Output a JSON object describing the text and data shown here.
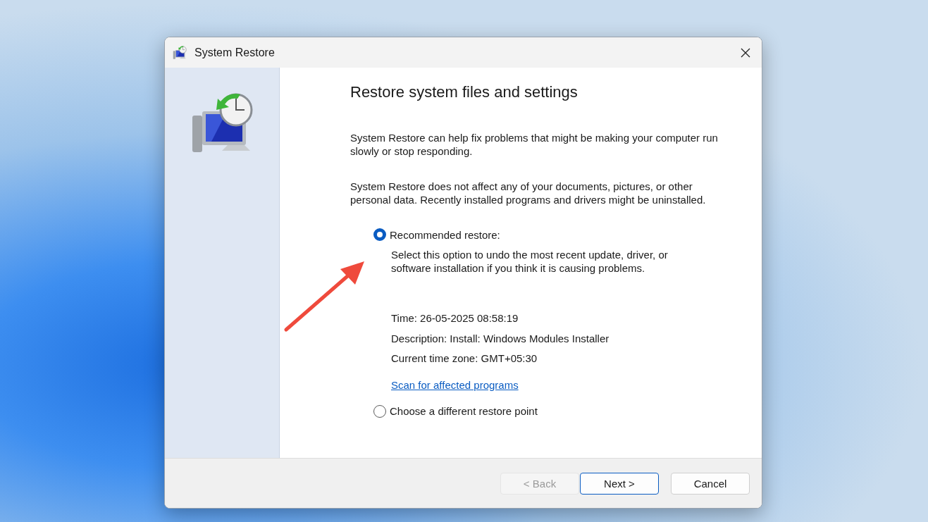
{
  "window": {
    "title": "System Restore"
  },
  "heading": "Restore system files and settings",
  "paragraphs": [
    "System Restore can help fix problems that might be making your computer run slowly or stop responding.",
    "System Restore does not affect any of your documents, pictures, or other personal data. Recently installed programs and drivers might be uninstalled."
  ],
  "options": [
    {
      "label": "Recommended restore:",
      "selected": true,
      "description": "Select this option to undo the most recent update, driver, or software installation if you think it is causing problems.",
      "details": [
        "Time: 26-05-2025 08:58:19",
        "Description: Install: Windows Modules Installer",
        "Current time zone: GMT+05:30"
      ],
      "link": "Scan for affected programs"
    },
    {
      "label": "Choose a different restore point",
      "selected": false
    }
  ],
  "buttons": [
    {
      "label": "< Back",
      "disabled": true,
      "default": false
    },
    {
      "label": "Next >",
      "disabled": false,
      "default": true
    },
    {
      "label": "Cancel",
      "disabled": false,
      "default": false
    }
  ]
}
